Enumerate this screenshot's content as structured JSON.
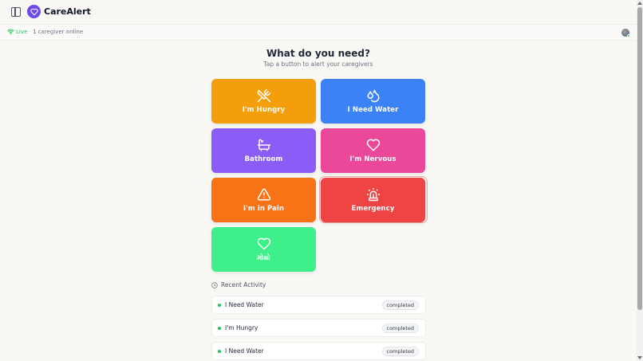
{
  "app": {
    "title": "CareAlert",
    "logo_icon": "heart-icon",
    "brand_color": "#6d4ae8"
  },
  "status": {
    "live_label": "Live",
    "separator": "·",
    "online_text": "1 caregiver online",
    "live_color": "#22c55e"
  },
  "main": {
    "title": "What do you need?",
    "subtitle": "Tap a button to alert your caregivers",
    "alerts": [
      {
        "label": "I'm Hungry",
        "icon": "utensils-crossed-icon",
        "color": "#f59e0b"
      },
      {
        "label": "I Need Water",
        "icon": "droplets-icon",
        "color": "#3b82f6"
      },
      {
        "label": "Bathroom",
        "icon": "bath-icon",
        "color": "#8b5cf6"
      },
      {
        "label": "I'm Nervous",
        "icon": "heart-icon",
        "color": "#ec4899"
      },
      {
        "label": "I'm in Pain",
        "icon": "alert-triangle-icon",
        "color": "#f97316"
      },
      {
        "label": "Emergency",
        "icon": "siren-icon",
        "color": "#ef4444"
      },
      {
        "label": "મોક્ષો",
        "icon": "heart-icon",
        "color": "#3ef08a"
      }
    ]
  },
  "recent": {
    "title": "Recent Activity",
    "icon": "clock-icon",
    "items": [
      {
        "label": "I Need Water",
        "status": "completed"
      },
      {
        "label": "I'm Hungry",
        "status": "completed"
      },
      {
        "label": "I Need Water",
        "status": "completed"
      }
    ]
  }
}
